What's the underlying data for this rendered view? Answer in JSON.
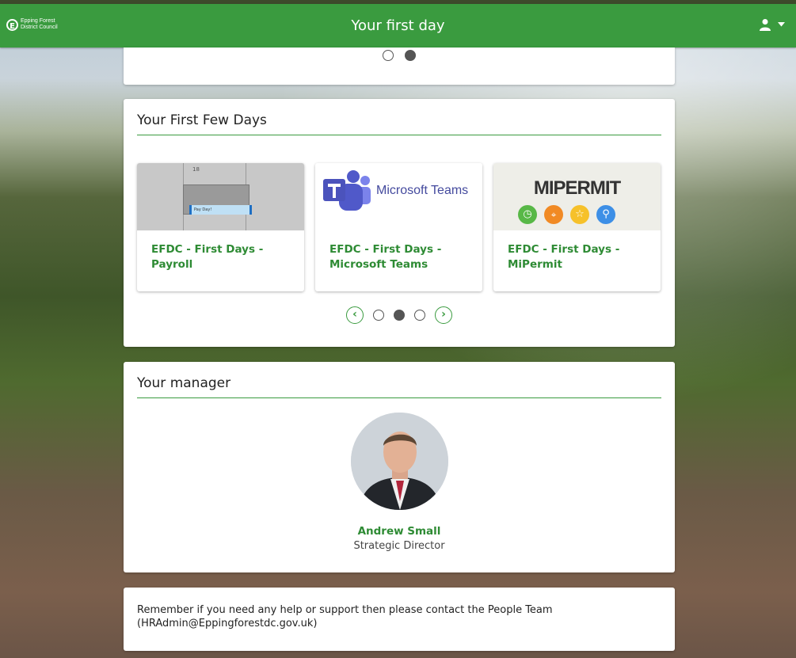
{
  "header": {
    "logo_mark": "E",
    "logo_line1": "Epping Forest",
    "logo_line2": "District Council",
    "title": "Your first day",
    "user_icon": "user-icon",
    "caret_icon": "caret-down-icon"
  },
  "top_carousel": {
    "dots": 2,
    "active": 2
  },
  "first_days": {
    "title": "Your First Few Days",
    "tiles": [
      {
        "title": "EFDC - First Days - Payroll",
        "thumb": "payroll",
        "thumb_text": "Pay Day!",
        "thumb_number": "18"
      },
      {
        "title": "EFDC - First Days - Microsoft Teams",
        "thumb": "teams",
        "thumb_text": "Microsoft Teams"
      },
      {
        "title": "EFDC - First Days - MiPermit",
        "thumb": "mipermit",
        "thumb_text": "MIPERMIT"
      }
    ],
    "carousel": {
      "dots": 3,
      "active": 2
    }
  },
  "manager": {
    "title": "Your manager",
    "name": "Andrew Small",
    "role": "Strategic Director"
  },
  "help": {
    "text": "Remember if you need any help or support then please contact the People Team (HRAdmin@Eppingforestdc.gov.uk)"
  },
  "colors": {
    "brand_green": "#3a9b3f",
    "link_green": "#2e8b34"
  }
}
